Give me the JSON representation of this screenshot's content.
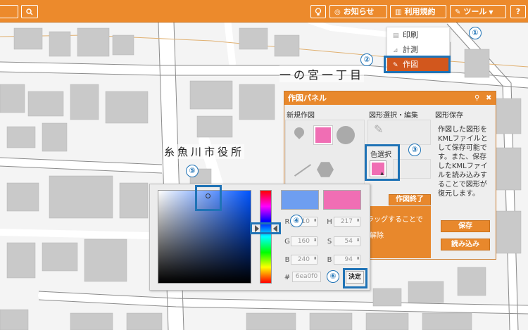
{
  "toolbar": {
    "search_icon": "search-icon",
    "bulb_icon": "lightbulb-icon",
    "news_label": "お知らせ",
    "terms_label": "利用規約",
    "tools_label": "ツール",
    "help_label": "?"
  },
  "tool_menu": {
    "items": [
      {
        "label": "印刷",
        "icon": "print-icon"
      },
      {
        "label": "計測",
        "icon": "measure-icon"
      },
      {
        "label": "作図",
        "icon": "pencil-icon",
        "active": true
      }
    ]
  },
  "map": {
    "place_label_1": "一の宮一丁目",
    "place_label_2": "糸魚川市役所"
  },
  "markers": [
    "①",
    "②",
    "③",
    "④",
    "⑤",
    "⑥"
  ],
  "draw_panel": {
    "title": "作図パネル",
    "pin_icon": "pin-icon",
    "close_icon": "close-icon",
    "new_drawing_label": "新規作図",
    "shape_select_label": "図形選択・編集",
    "shape_save_label": "図形保存",
    "color_select_label": "色選択",
    "description": "作図した図形をKMLファイルとして保存可能です。また、保存したKMLファイルを読み込みすることで図形が復元します。",
    "finish_button": "作図終了",
    "drag_hint": "ラッグすることで",
    "release_label": "解除",
    "save_button": "保存",
    "load_button": "読み込み"
  },
  "color_picker": {
    "current_color": "#6e9ef0",
    "new_color": "#f06eb4",
    "fields_left": [
      {
        "label": "R",
        "value": "110"
      },
      {
        "label": "G",
        "value": "160"
      },
      {
        "label": "B",
        "value": "240"
      }
    ],
    "fields_right": [
      {
        "label": "H",
        "value": "217"
      },
      {
        "label": "S",
        "value": "54"
      },
      {
        "label": "B",
        "value": "94"
      }
    ],
    "hex_label": "#",
    "hex_value": "6ea0f0",
    "ok_button": "決定"
  },
  "colors": {
    "toolbar": "#ec8a2c",
    "accent_blue": "#1f73b6",
    "menu_active": "#d2571d"
  }
}
